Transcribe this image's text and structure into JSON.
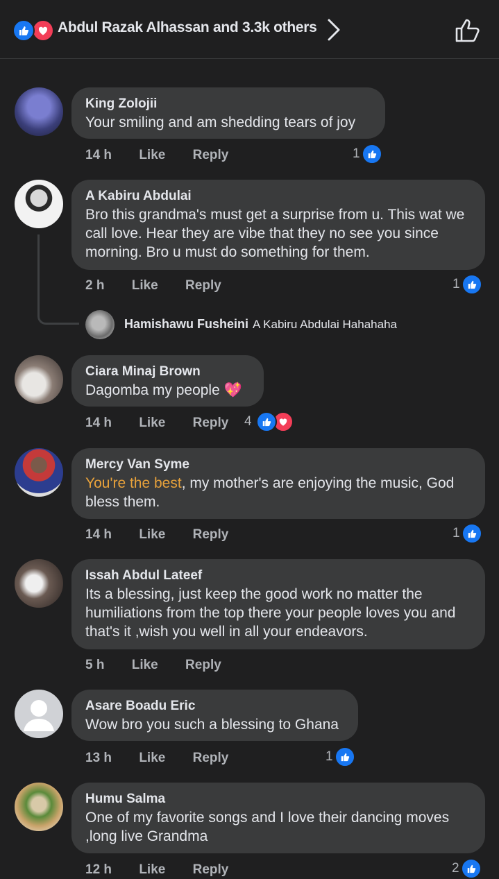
{
  "header": {
    "reactions_summary": "Abdul Razak Alhassan and 3.3k others",
    "reaction_icons": [
      "like-icon",
      "love-icon"
    ]
  },
  "comments": [
    {
      "name": "King Zolojii",
      "text": "Your smiling and am shedding tears of joy",
      "time": "14 h",
      "like": "Like",
      "reply": "Reply",
      "reaction_count": "1",
      "reactions": [
        "like"
      ]
    },
    {
      "name": "A Kabiru Abdulai",
      "text": "Bro this grandma's must get a surprise from u.  This wat we call love. Hear they are vibe that they no see you since morning. Bro u must do something for them.",
      "time": "2 h",
      "like": "Like",
      "reply": "Reply",
      "reaction_count": "1",
      "reactions": [
        "like"
      ],
      "sub_reply": {
        "name": "Hamishawu Fusheini",
        "text": "A Kabiru Abdulai Hahahaha"
      }
    },
    {
      "name": "Ciara Minaj Brown",
      "text": "Dagomba my people",
      "emoji": "💖",
      "time": "14 h",
      "like": "Like",
      "reply": "Reply",
      "reaction_count": "4",
      "reactions": [
        "like",
        "love"
      ]
    },
    {
      "name": "Mercy Van Syme",
      "highlight": "You're the best",
      "text": ", my mother's are enjoying the music, God bless them.",
      "time": "14 h",
      "like": "Like",
      "reply": "Reply",
      "reaction_count": "1",
      "reactions": [
        "like"
      ]
    },
    {
      "name": "Issah Abdul Lateef",
      "text": "Its a blessing, just keep the good work no matter the humiliations from the top there your people loves you and that's it ,wish you well in all your endeavors.",
      "time": "5 h",
      "like": "Like",
      "reply": "Reply"
    },
    {
      "name": "Asare Boadu Eric",
      "text": "Wow bro you such a blessing to Ghana",
      "time": "13 h",
      "like": "Like",
      "reply": "Reply",
      "reaction_count": "1",
      "reactions": [
        "like"
      ]
    },
    {
      "name": "Humu Salma",
      "text": "One of my favorite songs and I love their dancing moves ,long live Grandma",
      "time": "12 h",
      "like": "Like",
      "reply": "Reply",
      "reaction_count": "2",
      "reactions": [
        "like"
      ]
    }
  ],
  "colors": {
    "background": "#1f1f20",
    "bubble": "#3a3b3c",
    "like_blue": "#1877f2",
    "love_red": "#f33e58",
    "highlight": "#e8a23b"
  }
}
